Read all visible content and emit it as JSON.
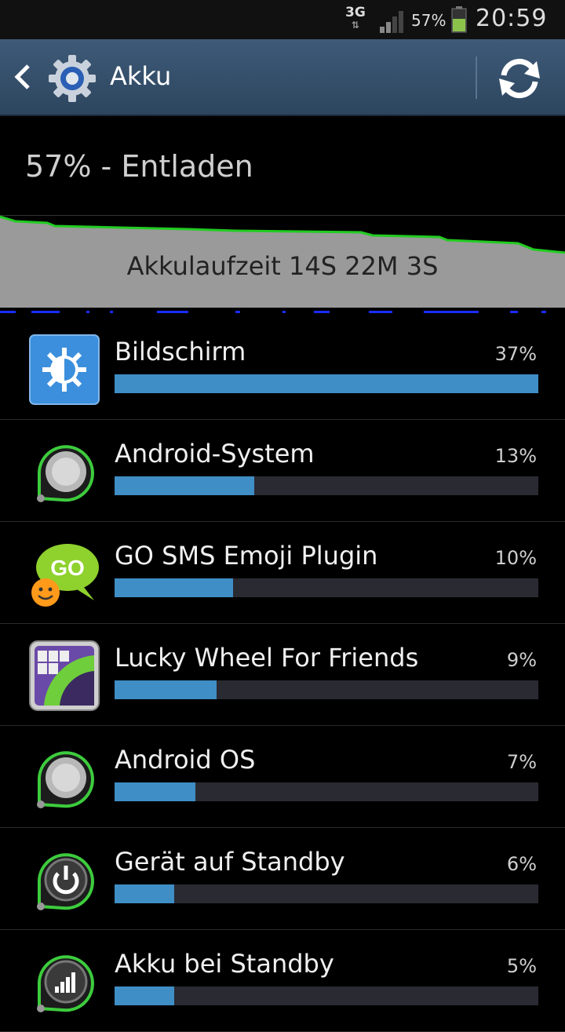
{
  "status_bar": {
    "network": "3G",
    "battery_percent": "57%",
    "battery_level": 0.57,
    "time": "20:59",
    "battery_color": "#8bc34a"
  },
  "action_bar": {
    "title": "Akku",
    "back_icon": "chevron-left-icon",
    "app_icon": "settings-gear-icon",
    "refresh_icon": "refresh-icon"
  },
  "summary": {
    "status": "57% - Entladen",
    "graph_label": "Akkulaufzeit 14S 22M 3S"
  },
  "accent_color": "#3f8ec5",
  "apps": [
    {
      "name": "Bildschirm",
      "percent": "37%",
      "share": 1.0,
      "icon": "display-brightness-icon"
    },
    {
      "name": "Android-System",
      "percent": "13%",
      "share": 0.33,
      "icon": "android-system-icon"
    },
    {
      "name": "GO SMS Emoji Plugin",
      "percent": "10%",
      "share": 0.28,
      "icon": "go-sms-emoji-icon"
    },
    {
      "name": "Lucky Wheel For Friends",
      "percent": "9%",
      "share": 0.24,
      "icon": "lucky-wheel-icon"
    },
    {
      "name": "Android OS",
      "percent": "7%",
      "share": 0.19,
      "icon": "android-os-icon"
    },
    {
      "name": "Gerät auf Standby",
      "percent": "6%",
      "share": 0.14,
      "icon": "standby-power-icon"
    },
    {
      "name": "Akku bei Standby",
      "percent": "5%",
      "share": 0.14,
      "icon": "signal-bars-icon"
    }
  ]
}
